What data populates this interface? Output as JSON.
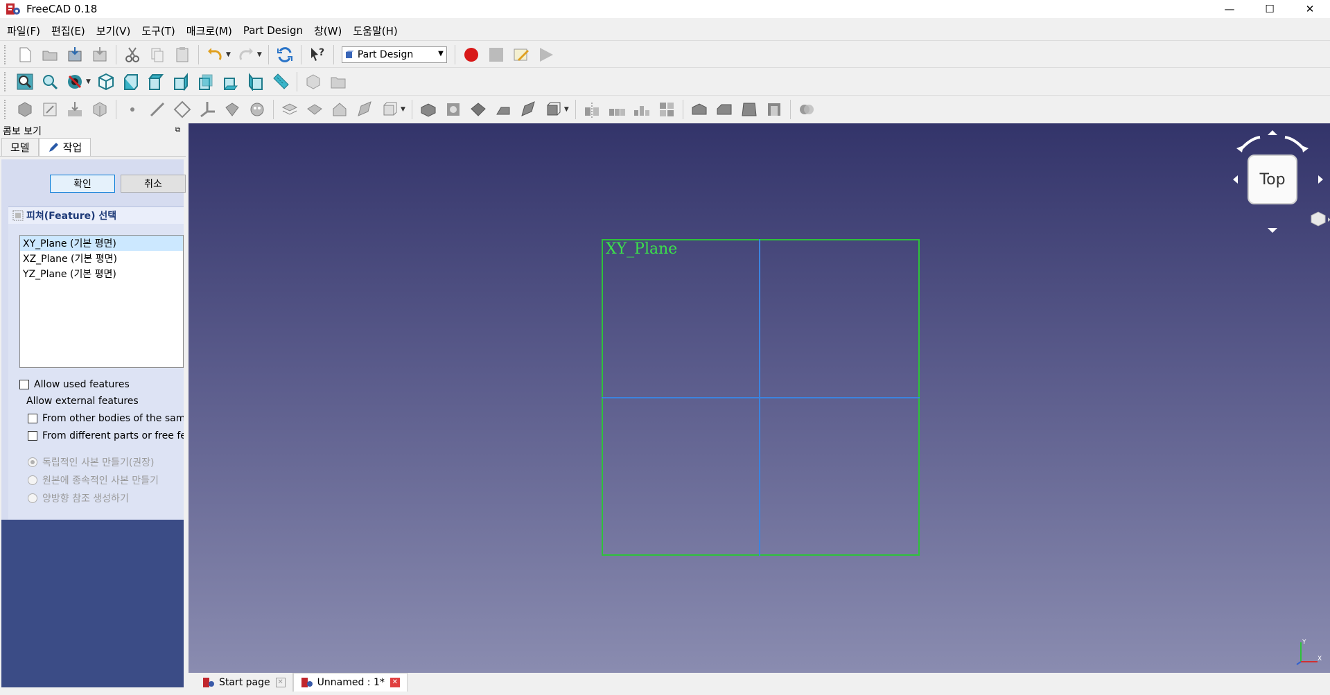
{
  "window": {
    "title": "FreeCAD 0.18",
    "minimize": "—",
    "maximize": "☐",
    "close": "✕"
  },
  "menu": [
    "파일(F)",
    "편집(E)",
    "보기(V)",
    "도구(T)",
    "매크로(M)",
    "Part Design",
    "창(W)",
    "도움말(H)"
  ],
  "toolbar": {
    "workbench": "Part Design"
  },
  "combo": {
    "header": "콤보 보기",
    "tabs": [
      "모델",
      "작업"
    ],
    "ok_label": "확인",
    "cancel_label": "취소",
    "feature_title": "피쳐(Feature) 선택",
    "features": [
      "XY_Plane (기본 평면)",
      "XZ_Plane (기본 평면)",
      "YZ_Plane (기본 평면)"
    ],
    "allow_used": "Allow used features",
    "allow_external": "Allow external features",
    "from_other_bodies": "From other bodies of the same",
    "from_different_parts": "From different parts or free feat",
    "radio_independent": "독립적인 사본 만들기(권장)",
    "radio_dependent": "원본에 종속적인 사본 만들기",
    "radio_cross": "양방향 참조 생성하기"
  },
  "view": {
    "plane_label": "XY_Plane",
    "navcube_face": "Top"
  },
  "doc_tabs": {
    "start": "Start page",
    "unnamed": "Unnamed : 1*"
  },
  "colors": {
    "plane_border": "#2ec23a",
    "axis_line": "#3b84e0",
    "view_top": "#33346a",
    "view_bottom": "#8a8cb0"
  }
}
